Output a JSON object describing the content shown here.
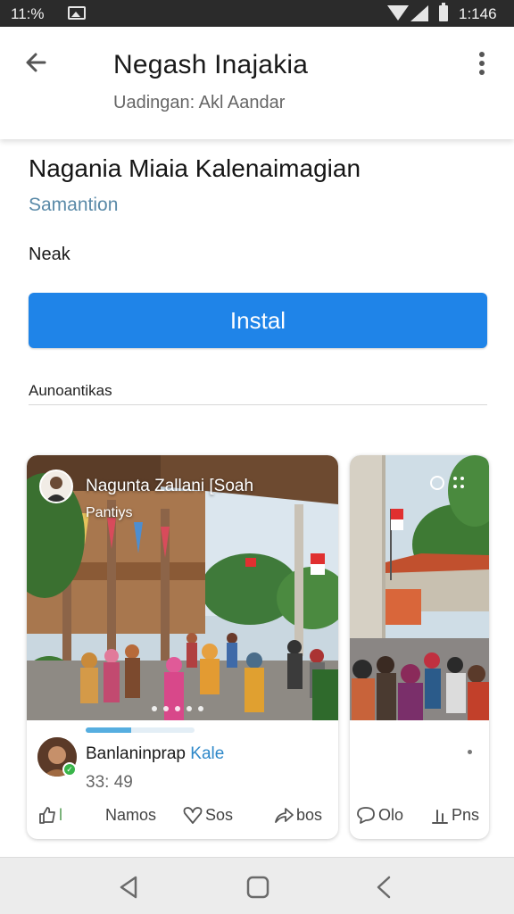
{
  "status_bar": {
    "time_left": "11:% ",
    "time_right": "1:146"
  },
  "app_bar": {
    "title": "Negash Inajakia",
    "subtitle": "Uadingan: Akl Aandar"
  },
  "content": {
    "title": "Nagania Miaia Kalenaimagian",
    "link": "Samantion",
    "label": "Neak",
    "install_label": "Instal",
    "section_label": "Aunoantikas"
  },
  "cards": [
    {
      "photo_title": "Nagunta Zallani [Soah",
      "photo_subtitle": "Pantiys",
      "progress": 0.42,
      "author": "Banlaninprap ",
      "author_accent": "Kale",
      "time": "33: 49",
      "actions": {
        "like_count": "l",
        "names": "Namos",
        "love": "Sos",
        "share": "bos"
      }
    },
    {
      "actions": {
        "comments": "Olo",
        "stats": "Pns"
      }
    }
  ],
  "colors": {
    "accent": "#1f84e8",
    "link": "#5a8aa8",
    "progress": "#56aee0",
    "status_bar": "#2b2b2b"
  },
  "icons": [
    "back-arrow-icon",
    "more-vert-icon",
    "gallery-icon",
    "wifi-icon",
    "signal-icon",
    "battery-icon",
    "like-icon",
    "heart-icon",
    "share-icon",
    "comment-icon",
    "stats-icon",
    "nav-back-icon",
    "nav-home-icon",
    "nav-recent-icon"
  ]
}
